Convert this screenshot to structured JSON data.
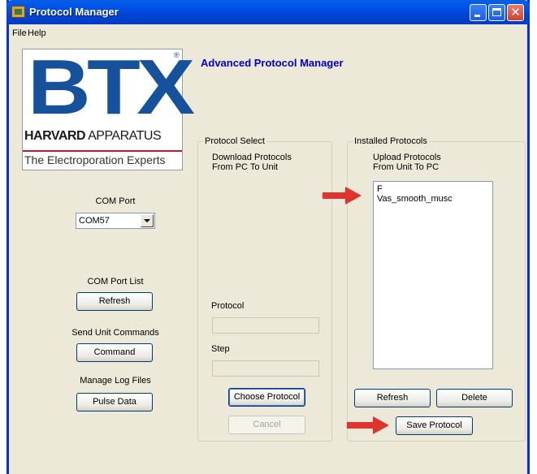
{
  "window": {
    "title": "Protocol Manager"
  },
  "menu": {
    "file": "File",
    "help": "Help"
  },
  "logo": {
    "btx": "BTX",
    "reg": "®",
    "harvard_bold": "HARVARD",
    "harvard_rest": " APPARATUS",
    "tagline": "The Electroporation Experts"
  },
  "heading": "Advanced Protocol Manager",
  "com_port": {
    "label": "COM Port",
    "value": "COM57"
  },
  "com_port_list": {
    "label": "COM Port List",
    "button": "Refresh"
  },
  "unit_commands": {
    "label": "Send Unit Commands",
    "button": "Command"
  },
  "log_files": {
    "label": "Manage Log Files",
    "button": "Pulse Data"
  },
  "protocol_select": {
    "group": "Protocol Select",
    "desc_line1": "Download Protocols",
    "desc_line2": "From PC To Unit",
    "protocol_label": "Protocol",
    "step_label": "Step",
    "choose_button": "Choose Protocol",
    "cancel_button": "Cancel"
  },
  "installed": {
    "group": "Installed Protocols",
    "desc_line1": "Upload Protocols",
    "desc_line2": "From Unit To PC",
    "items": [
      "F",
      "Vas_smooth_musc"
    ],
    "refresh_button": "Refresh",
    "delete_button": "Delete",
    "save_button": "Save Protocol"
  },
  "colors": {
    "accent": "#0000cc",
    "arrow": "#e0332e",
    "logo_blue": "#16519c"
  }
}
